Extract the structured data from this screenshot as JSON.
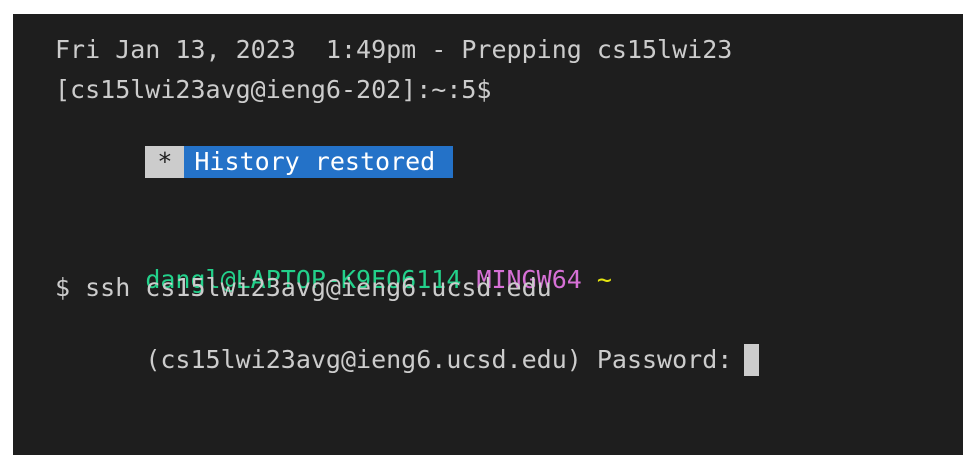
{
  "terminal": {
    "banner_line": "Fri Jan 13, 2023  1:49pm - Prepping cs15lwi23",
    "remote_prompt": "[cs15lwi23avg@ieng6-202]:~:5$",
    "history_star": "*",
    "history_restored": "History restored",
    "local_prompt": {
      "user_host": "dangl@LAPTOP-K9EO6114",
      "shell": "MINGW64",
      "cwd": "~"
    },
    "command_line": "$ ssh cs15lwi23avg@ieng6.ucsd.edu",
    "password_prompt": "(cs15lwi23avg@ieng6.ucsd.edu) Password:"
  },
  "colors": {
    "background": "#1e1e1e",
    "foreground": "#cccccc",
    "user_host": "#23d18b",
    "shell_label": "#d670d6",
    "cwd_tilde": "#e5e510",
    "history_highlight": "#2472c8"
  },
  "icons": {
    "cursor": "block-cursor"
  }
}
